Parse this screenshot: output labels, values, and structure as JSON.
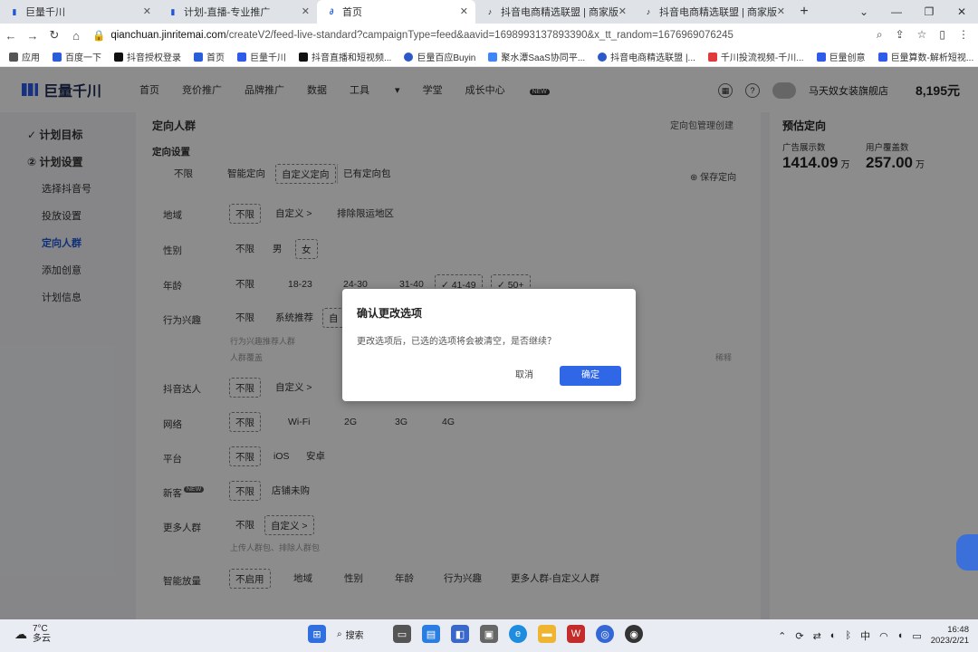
{
  "browser": {
    "tabs": [
      {
        "title": "巨量千川",
        "active": false
      },
      {
        "title": "计划-直播-专业推广",
        "active": false
      },
      {
        "title": "首页",
        "active": true
      },
      {
        "title": "抖音电商精选联盟 | 商家版",
        "active": false
      },
      {
        "title": "抖音电商精选联盟 | 商家版",
        "active": false
      }
    ],
    "url_domain": "qianchuan.jinritemai.com",
    "url_path": "/createV2/feed-live-standard?campaignType=feed&aavid=1698993137893390&x_tt_random=1676969076245",
    "bookmarks": [
      "应用",
      "百度一下",
      "抖音授权登录",
      "首页",
      "巨量千川",
      "抖音直播和短视频...",
      "巨量百应Buyin",
      "聚水潭SaaS协同平...",
      "抖音电商精选联盟 |...",
      "千川投流视频-千川...",
      "巨量创意",
      "巨量算数-解析短视..."
    ]
  },
  "app": {
    "logo": "巨量千川",
    "menu": [
      "首页",
      "竞价推广",
      "品牌推广",
      "数据",
      "工具",
      "学堂",
      "成长中心"
    ],
    "menu_badge": "NEW",
    "account_name": "马天奴女装旗舰店",
    "balance": "8,195元"
  },
  "sidebar": {
    "items": [
      "计划目标",
      "计划设置",
      "选择抖音号",
      "投放设置",
      "定向人群",
      "添加创意",
      "计划信息"
    ]
  },
  "targeting": {
    "section_title": "定向人群",
    "link_text": "定向包管理创建",
    "sub_title": "定向设置",
    "modes": [
      "不限",
      "智能定向",
      "自定义定向",
      "已有定向包"
    ],
    "save_link": "保存定向",
    "rows": {
      "region": {
        "label": "地域",
        "options": [
          "不限",
          "自定义 >",
          "排除限运地区"
        ]
      },
      "gender": {
        "label": "性别",
        "options": [
          "不限",
          "男",
          "女"
        ]
      },
      "age": {
        "label": "年龄",
        "options": [
          "不限",
          "18-23",
          "24-30",
          "31-40",
          "41-49",
          "50+"
        ]
      },
      "interest": {
        "label": "行为兴趣",
        "options": [
          "不限",
          "系统推荐",
          "自"
        ],
        "hint1": "行为兴趣推荐人群",
        "hint2": "人群覆盖"
      },
      "douyin": {
        "label": "抖音达人",
        "options": [
          "不限",
          "自定义 >"
        ]
      },
      "network": {
        "label": "网络",
        "options": [
          "不限",
          "Wi-Fi",
          "2G",
          "3G",
          "4G"
        ]
      },
      "platform": {
        "label": "平台",
        "options": [
          "不限",
          "iOS",
          "安卓"
        ]
      },
      "newcomer": {
        "label": "新客",
        "badge": "NEW",
        "options": [
          "不限",
          "店铺未购"
        ]
      },
      "more": {
        "label": "更多人群",
        "options": [
          "不限",
          "自定义 >"
        ],
        "hint": "上传人群包、排除人群包"
      },
      "smart": {
        "label": "智能放量",
        "options": [
          "不启用",
          "地域",
          "性别",
          "年龄",
          "行为兴趣",
          "更多人群-自定义人群"
        ]
      }
    },
    "right_faint": "稀释"
  },
  "estimate": {
    "title": "预估定向",
    "impressions_label": "广告展示数",
    "impressions_value": "1414.09",
    "impressions_unit": "万",
    "users_label": "用户覆盖数",
    "users_value": "257.00",
    "users_unit": "万"
  },
  "dialog": {
    "title": "确认更改选项",
    "body": "更改选项后，已选的选项将会被清空，是否继续？",
    "cancel": "取消",
    "confirm": "确定"
  },
  "taskbar": {
    "temp": "7°C",
    "weather": "多云",
    "search": "搜索",
    "ime": "中",
    "time": "16:48",
    "date": "2023/2/21"
  }
}
